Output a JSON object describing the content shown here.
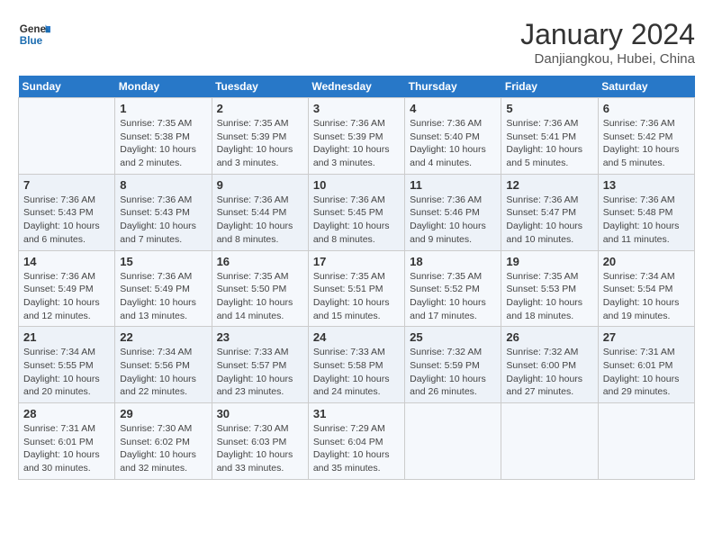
{
  "header": {
    "logo_general": "General",
    "logo_blue": "Blue",
    "title": "January 2024",
    "subtitle": "Danjiangkou, Hubei, China"
  },
  "days_of_week": [
    "Sunday",
    "Monday",
    "Tuesday",
    "Wednesday",
    "Thursday",
    "Friday",
    "Saturday"
  ],
  "weeks": [
    [
      {
        "day": "",
        "info": []
      },
      {
        "day": "1",
        "info": [
          "Sunrise: 7:35 AM",
          "Sunset: 5:38 PM",
          "Daylight: 10 hours",
          "and 2 minutes."
        ]
      },
      {
        "day": "2",
        "info": [
          "Sunrise: 7:35 AM",
          "Sunset: 5:39 PM",
          "Daylight: 10 hours",
          "and 3 minutes."
        ]
      },
      {
        "day": "3",
        "info": [
          "Sunrise: 7:36 AM",
          "Sunset: 5:39 PM",
          "Daylight: 10 hours",
          "and 3 minutes."
        ]
      },
      {
        "day": "4",
        "info": [
          "Sunrise: 7:36 AM",
          "Sunset: 5:40 PM",
          "Daylight: 10 hours",
          "and 4 minutes."
        ]
      },
      {
        "day": "5",
        "info": [
          "Sunrise: 7:36 AM",
          "Sunset: 5:41 PM",
          "Daylight: 10 hours",
          "and 5 minutes."
        ]
      },
      {
        "day": "6",
        "info": [
          "Sunrise: 7:36 AM",
          "Sunset: 5:42 PM",
          "Daylight: 10 hours",
          "and 5 minutes."
        ]
      }
    ],
    [
      {
        "day": "7",
        "info": [
          "Sunrise: 7:36 AM",
          "Sunset: 5:43 PM",
          "Daylight: 10 hours",
          "and 6 minutes."
        ]
      },
      {
        "day": "8",
        "info": [
          "Sunrise: 7:36 AM",
          "Sunset: 5:43 PM",
          "Daylight: 10 hours",
          "and 7 minutes."
        ]
      },
      {
        "day": "9",
        "info": [
          "Sunrise: 7:36 AM",
          "Sunset: 5:44 PM",
          "Daylight: 10 hours",
          "and 8 minutes."
        ]
      },
      {
        "day": "10",
        "info": [
          "Sunrise: 7:36 AM",
          "Sunset: 5:45 PM",
          "Daylight: 10 hours",
          "and 8 minutes."
        ]
      },
      {
        "day": "11",
        "info": [
          "Sunrise: 7:36 AM",
          "Sunset: 5:46 PM",
          "Daylight: 10 hours",
          "and 9 minutes."
        ]
      },
      {
        "day": "12",
        "info": [
          "Sunrise: 7:36 AM",
          "Sunset: 5:47 PM",
          "Daylight: 10 hours",
          "and 10 minutes."
        ]
      },
      {
        "day": "13",
        "info": [
          "Sunrise: 7:36 AM",
          "Sunset: 5:48 PM",
          "Daylight: 10 hours",
          "and 11 minutes."
        ]
      }
    ],
    [
      {
        "day": "14",
        "info": [
          "Sunrise: 7:36 AM",
          "Sunset: 5:49 PM",
          "Daylight: 10 hours",
          "and 12 minutes."
        ]
      },
      {
        "day": "15",
        "info": [
          "Sunrise: 7:36 AM",
          "Sunset: 5:49 PM",
          "Daylight: 10 hours",
          "and 13 minutes."
        ]
      },
      {
        "day": "16",
        "info": [
          "Sunrise: 7:35 AM",
          "Sunset: 5:50 PM",
          "Daylight: 10 hours",
          "and 14 minutes."
        ]
      },
      {
        "day": "17",
        "info": [
          "Sunrise: 7:35 AM",
          "Sunset: 5:51 PM",
          "Daylight: 10 hours",
          "and 15 minutes."
        ]
      },
      {
        "day": "18",
        "info": [
          "Sunrise: 7:35 AM",
          "Sunset: 5:52 PM",
          "Daylight: 10 hours",
          "and 17 minutes."
        ]
      },
      {
        "day": "19",
        "info": [
          "Sunrise: 7:35 AM",
          "Sunset: 5:53 PM",
          "Daylight: 10 hours",
          "and 18 minutes."
        ]
      },
      {
        "day": "20",
        "info": [
          "Sunrise: 7:34 AM",
          "Sunset: 5:54 PM",
          "Daylight: 10 hours",
          "and 19 minutes."
        ]
      }
    ],
    [
      {
        "day": "21",
        "info": [
          "Sunrise: 7:34 AM",
          "Sunset: 5:55 PM",
          "Daylight: 10 hours",
          "and 20 minutes."
        ]
      },
      {
        "day": "22",
        "info": [
          "Sunrise: 7:34 AM",
          "Sunset: 5:56 PM",
          "Daylight: 10 hours",
          "and 22 minutes."
        ]
      },
      {
        "day": "23",
        "info": [
          "Sunrise: 7:33 AM",
          "Sunset: 5:57 PM",
          "Daylight: 10 hours",
          "and 23 minutes."
        ]
      },
      {
        "day": "24",
        "info": [
          "Sunrise: 7:33 AM",
          "Sunset: 5:58 PM",
          "Daylight: 10 hours",
          "and 24 minutes."
        ]
      },
      {
        "day": "25",
        "info": [
          "Sunrise: 7:32 AM",
          "Sunset: 5:59 PM",
          "Daylight: 10 hours",
          "and 26 minutes."
        ]
      },
      {
        "day": "26",
        "info": [
          "Sunrise: 7:32 AM",
          "Sunset: 6:00 PM",
          "Daylight: 10 hours",
          "and 27 minutes."
        ]
      },
      {
        "day": "27",
        "info": [
          "Sunrise: 7:31 AM",
          "Sunset: 6:01 PM",
          "Daylight: 10 hours",
          "and 29 minutes."
        ]
      }
    ],
    [
      {
        "day": "28",
        "info": [
          "Sunrise: 7:31 AM",
          "Sunset: 6:01 PM",
          "Daylight: 10 hours",
          "and 30 minutes."
        ]
      },
      {
        "day": "29",
        "info": [
          "Sunrise: 7:30 AM",
          "Sunset: 6:02 PM",
          "Daylight: 10 hours",
          "and 32 minutes."
        ]
      },
      {
        "day": "30",
        "info": [
          "Sunrise: 7:30 AM",
          "Sunset: 6:03 PM",
          "Daylight: 10 hours",
          "and 33 minutes."
        ]
      },
      {
        "day": "31",
        "info": [
          "Sunrise: 7:29 AM",
          "Sunset: 6:04 PM",
          "Daylight: 10 hours",
          "and 35 minutes."
        ]
      },
      {
        "day": "",
        "info": []
      },
      {
        "day": "",
        "info": []
      },
      {
        "day": "",
        "info": []
      }
    ]
  ]
}
